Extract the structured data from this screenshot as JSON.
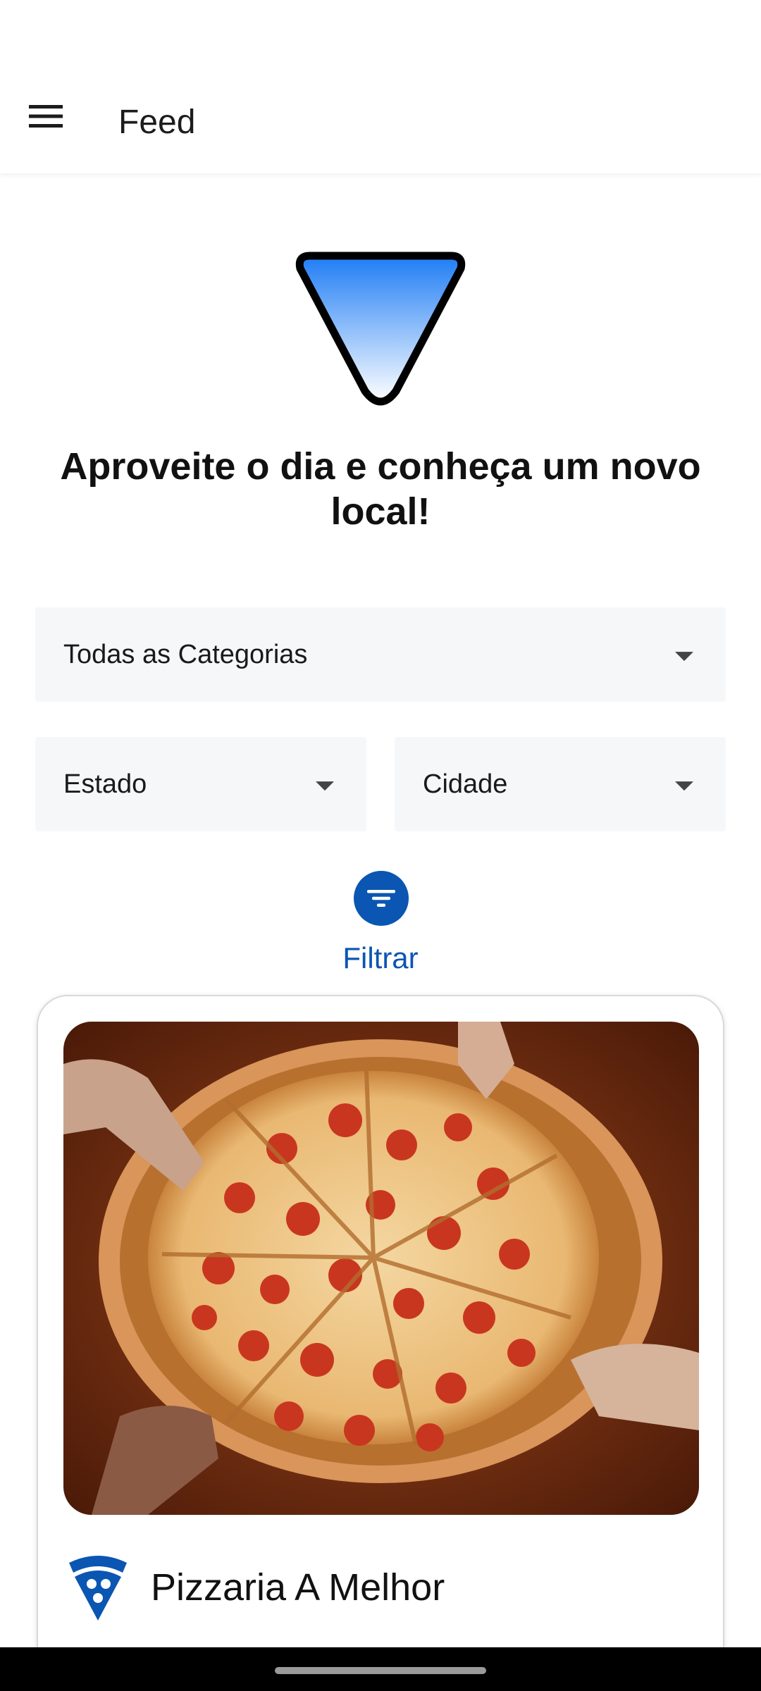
{
  "app_bar": {
    "title": "Feed"
  },
  "headline": "Aproveite o dia e conheça um novo local!",
  "filters": {
    "category": {
      "selected": "Todas as Categorias"
    },
    "state": {
      "selected": "Estado"
    },
    "city": {
      "selected": "Cidade"
    },
    "filter_button_label": "Filtrar"
  },
  "feed": {
    "items": [
      {
        "name": "Pizzaria A Melhor",
        "category_icon": "pizza-slice-icon",
        "image": "pepperoni-pizza-photo"
      }
    ]
  },
  "colors": {
    "accent": "#0a56b2",
    "select_background": "#f6f7f9",
    "logo_gradient_top": "#1f7df5",
    "logo_gradient_bottom": "#ffffff"
  }
}
